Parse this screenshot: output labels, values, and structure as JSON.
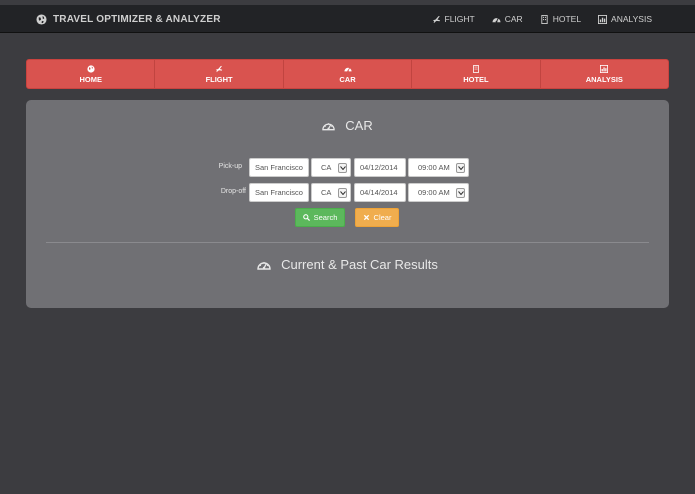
{
  "header": {
    "brand": "TRAVEL OPTIMIZER & ANALYZER",
    "nav": [
      {
        "label": "FLIGHT",
        "icon": "plane-icon"
      },
      {
        "label": "CAR",
        "icon": "dashboard-icon"
      },
      {
        "label": "HOTEL",
        "icon": "building-icon"
      },
      {
        "label": "ANALYSIS",
        "icon": "bar-chart-icon"
      }
    ]
  },
  "tabs": [
    {
      "label": "HOME",
      "icon": "globe-icon"
    },
    {
      "label": "FLIGHT",
      "icon": "plane-icon"
    },
    {
      "label": "CAR",
      "icon": "dashboard-icon"
    },
    {
      "label": "HOTEL",
      "icon": "building-icon"
    },
    {
      "label": "ANALYSIS",
      "icon": "bar-chart-icon"
    }
  ],
  "panel": {
    "title": "CAR",
    "pickup": {
      "label": "Pick-up",
      "city": "San Francisco",
      "state": "CA",
      "date": "04/12/2014",
      "time": "09:00 AM"
    },
    "dropoff": {
      "label": "Drop-off",
      "city": "San Francisco",
      "state": "CA",
      "date": "04/14/2014",
      "time": "09:00 AM"
    },
    "search_label": "Search",
    "clear_label": "Clear",
    "results_title": "Current & Past Car Results"
  },
  "colors": {
    "tab_bar": "#d9534f",
    "panel": "#707074",
    "background": "#3c3c40",
    "search": "#5cb85c",
    "clear": "#f0ad4e"
  }
}
